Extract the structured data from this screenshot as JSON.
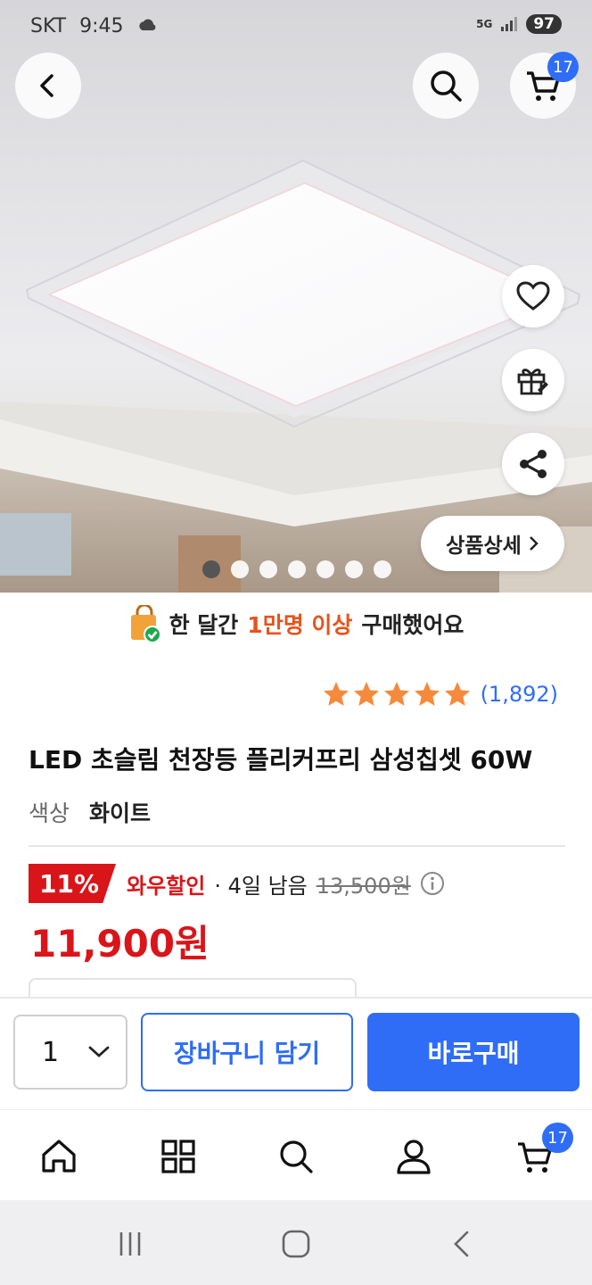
{
  "status_bar": {
    "carrier": "SKT",
    "time": "9:45",
    "network": "5G",
    "battery": "97"
  },
  "header": {
    "cart_count": "17"
  },
  "hero": {
    "detail_label": "상품상세",
    "image_count": 7,
    "active_image": 1
  },
  "promo": {
    "prefix": "한 달간",
    "highlight": "1만명 이상",
    "suffix": "구매했어요"
  },
  "rating": {
    "stars": 5,
    "count": "(1,892)"
  },
  "product": {
    "title": "LED 초슬림 천장등 플리커프리 삼성칩셋 60W",
    "option_label": "색상",
    "option_value": "화이트"
  },
  "price": {
    "discount": "11%",
    "wow_label": "와우할인",
    "remaining": "· 4일 남음",
    "original": "13,500원",
    "final": "11,900원"
  },
  "actions": {
    "quantity": "1",
    "add_to_cart": "장바구니 담기",
    "buy_now": "바로구매"
  },
  "bottom_nav": {
    "cart_count": "17"
  },
  "colors": {
    "accent": "#2f6df6",
    "sale": "#d9151a",
    "promo": "#e8521b",
    "star": "#f58a3c"
  }
}
